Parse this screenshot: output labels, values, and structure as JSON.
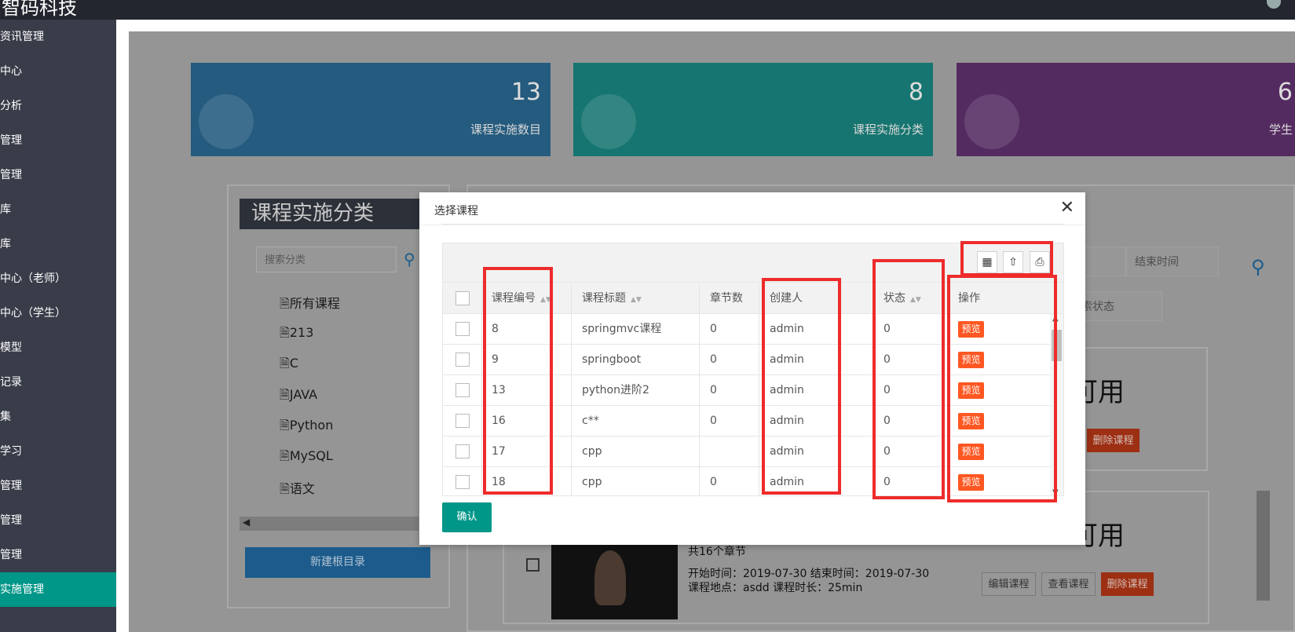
{
  "topbar": {
    "brand": "智码科技"
  },
  "sidebar": {
    "items": [
      {
        "label": "资讯管理"
      },
      {
        "label": "中心"
      },
      {
        "label": "分析"
      },
      {
        "label": "管理"
      },
      {
        "label": "管理"
      },
      {
        "label": "库"
      },
      {
        "label": "库"
      },
      {
        "label": "中心（老师）"
      },
      {
        "label": "中心（学生）"
      },
      {
        "label": "模型"
      },
      {
        "label": "记录"
      },
      {
        "label": "集"
      },
      {
        "label": "学习"
      },
      {
        "label": "管理"
      },
      {
        "label": "管理"
      },
      {
        "label": "管理"
      },
      {
        "label": "实施管理"
      }
    ]
  },
  "stats": [
    {
      "value": "13",
      "label": "课程实施数目",
      "color": "#245b7e"
    },
    {
      "value": "8",
      "label": "课程实施分类",
      "color": "#167570"
    },
    {
      "value": "6",
      "label": "学生",
      "color": "#542b61"
    }
  ],
  "category": {
    "title": "课程实施分类",
    "search_placeholder": "搜索分类",
    "items": [
      "所有课程",
      "213",
      "C",
      "JAVA",
      "Python",
      "MySQL",
      "语文"
    ],
    "new_root_label": "新建根目录"
  },
  "background": {
    "start_time_placeholder": "时间",
    "end_time_placeholder": "结束时间",
    "status_placeholder": "或搜索状态",
    "card1_status": "可用",
    "card2_status": "可用",
    "card2_chapters": "共16个章节",
    "card2_time": "开始时间：2019-07-30 结束时间：2019-07-30",
    "card2_place": "课程地点：asdd  课程时长：25min",
    "edit_label": "编辑课程",
    "view_label": "查看课程",
    "view_label_short": "程",
    "delete_label": "删除课程"
  },
  "modal": {
    "title": "选择课程",
    "close_glyph": "✕",
    "confirm_label": "确认",
    "columns": [
      "课程编号",
      "课程标题",
      "章节数",
      "创建人",
      "状态",
      "操作"
    ],
    "rows": [
      {
        "id": "8",
        "title": "springmvc课程",
        "chapters": "0",
        "creator": "admin",
        "status": "0",
        "action": "预览"
      },
      {
        "id": "9",
        "title": "springboot",
        "chapters": "0",
        "creator": "admin",
        "status": "0",
        "action": "预览"
      },
      {
        "id": "13",
        "title": "python进阶2",
        "chapters": "0",
        "creator": "admin",
        "status": "0",
        "action": "预览"
      },
      {
        "id": "16",
        "title": "c**",
        "chapters": "0",
        "creator": "admin",
        "status": "0",
        "action": "预览"
      },
      {
        "id": "17",
        "title": "cpp",
        "chapters": "",
        "creator": "admin",
        "status": "0",
        "action": "预览"
      },
      {
        "id": "18",
        "title": "cpp",
        "chapters": "0",
        "creator": "admin",
        "status": "0",
        "action": "预览"
      }
    ]
  },
  "icons": {
    "columns": "grid-icon",
    "export": "export-icon",
    "print": "print-icon",
    "search": "search-icon",
    "close": "close-icon"
  }
}
